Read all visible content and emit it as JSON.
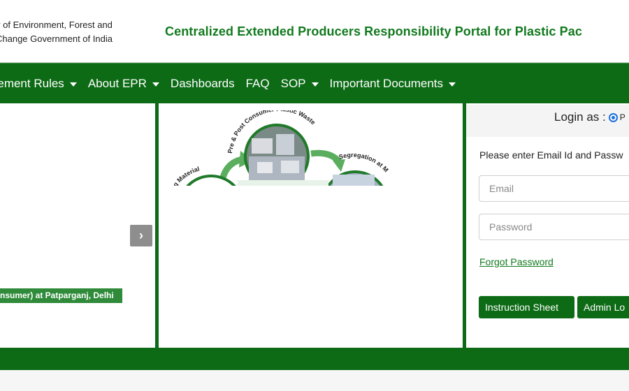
{
  "header": {
    "ministry_line1": "y of Environment, Forest and",
    "ministry_line2": "Change Government of India",
    "portal_title": "Centralized Extended Producers Responsibility Portal for Plastic Pac"
  },
  "nav": {
    "items": [
      {
        "label": "nagement Rules",
        "dropdown": true
      },
      {
        "label": "About EPR",
        "dropdown": true
      },
      {
        "label": "Dashboards",
        "dropdown": false
      },
      {
        "label": "FAQ",
        "dropdown": false
      },
      {
        "label": "SOP",
        "dropdown": true
      },
      {
        "label": "Important Documents",
        "dropdown": true
      }
    ]
  },
  "slider": {
    "next_label": "›",
    "caption": "nsumer) at Patparganj, Delhi"
  },
  "diagram": {
    "label_top": "Pre & Post Consumer Plastic Waste",
    "label_left": "g Material",
    "label_right": "Segregation at M"
  },
  "login": {
    "login_as": "Login as :",
    "radio_label": "P",
    "message": "Please enter Email Id and Passw",
    "email_placeholder": "Email",
    "password_placeholder": "Password",
    "forgot": "Forgot Password",
    "instruction_button": "Instruction Sheet",
    "admin_button": "Admin Lo"
  },
  "colors": {
    "brand_green": "#0d6b16",
    "title_green": "#127a1e",
    "caption_green": "#2f8b3a"
  }
}
